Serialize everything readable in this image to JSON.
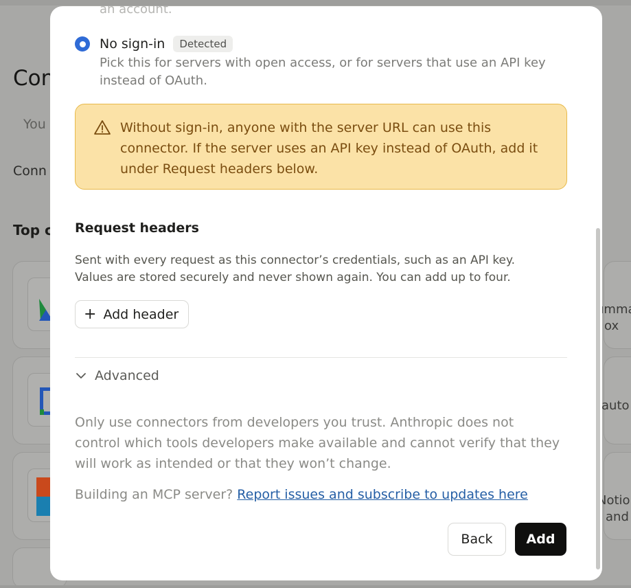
{
  "background": {
    "title": "Con",
    "tab": "You",
    "subtitle": "Conn",
    "section": "Top c",
    "right_texts": [
      "umma",
      "ox",
      "auto",
      "Notio",
      "and"
    ]
  },
  "modal": {
    "cut_text": "an account.",
    "radio": {
      "label": "No sign-in",
      "badge": "Detected",
      "description": "Pick this for servers with open access, or for servers that use an API key instead of OAuth."
    },
    "warning": {
      "text": "Without sign-in, anyone with the server URL can use this connector. If the server uses an API key instead of OAuth, add it under Request headers below."
    },
    "request_headers": {
      "title": "Request headers",
      "description": "Sent with every request as this connector’s credentials, such as an API key. Values are stored securely and never shown again. You can add up to four.",
      "add_button": "Add header"
    },
    "advanced_label": "Advanced",
    "disclaimer": "Only use connectors from developers you trust. Anthropic does not control which tools developers make available and cannot verify that they will work as intended or that they won’t change.",
    "building": {
      "prefix": "Building an MCP server?",
      "link": "Report issues and subscribe to updates here"
    },
    "buttons": {
      "back": "Back",
      "add": "Add"
    }
  },
  "colors": {
    "accent_radio": "#2f6bd6",
    "warning_bg": "#fbe2a7",
    "warning_border": "#e7b94a",
    "warning_text": "#7a4d10",
    "link": "#245ea5",
    "primary_button": "#0f0f0e"
  }
}
